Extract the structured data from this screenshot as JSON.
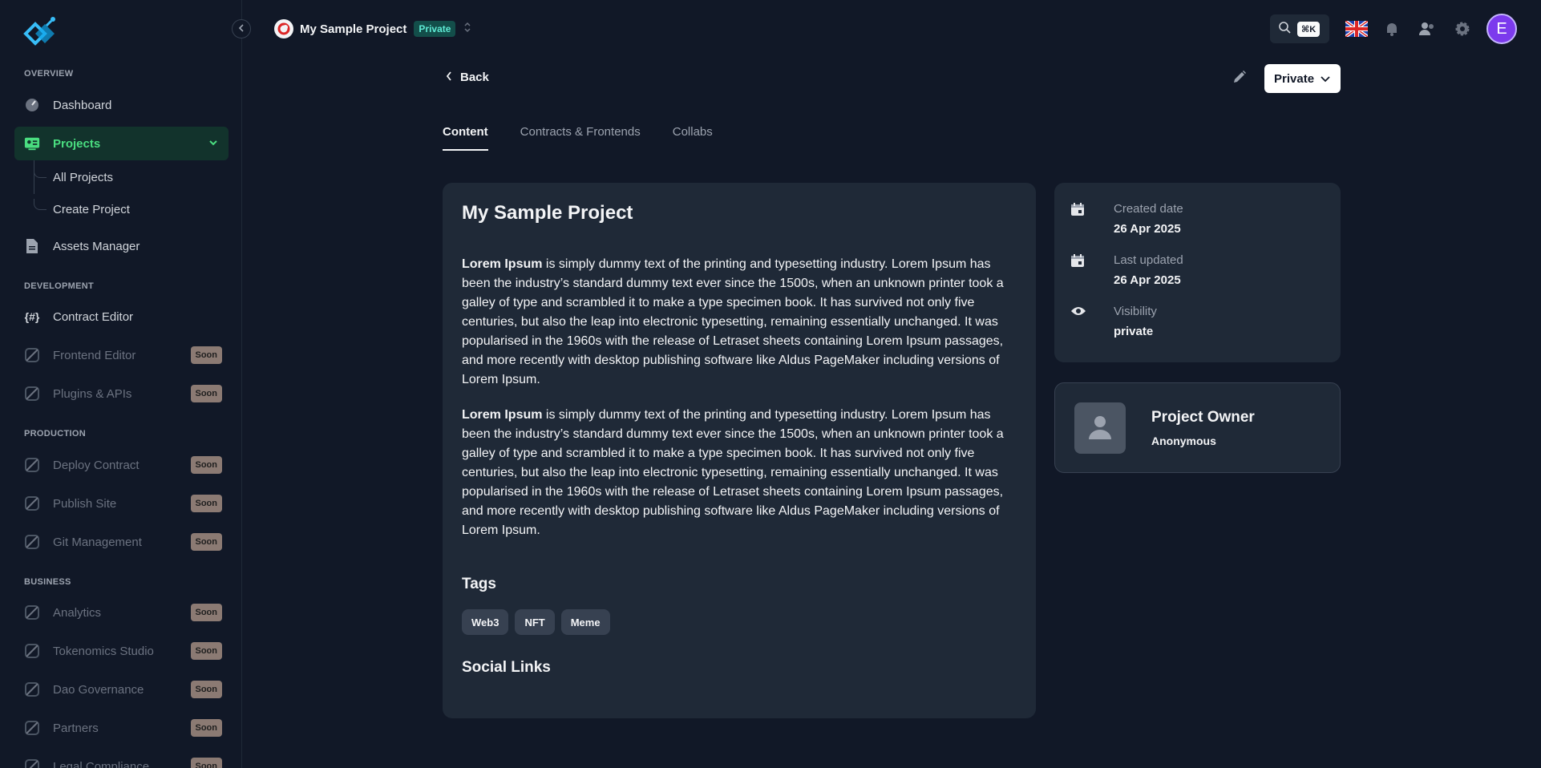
{
  "sidebar": {
    "sections": {
      "overview": "OVERVIEW",
      "development": "DEVELOPMENT",
      "production": "PRODUCTION",
      "business": "BUSINESS"
    },
    "items": {
      "dashboard": "Dashboard",
      "projects": "Projects",
      "all_projects": "All Projects",
      "create_project": "Create Project",
      "assets_manager": "Assets Manager",
      "contract_editor": "Contract Editor",
      "frontend_editor": "Frontend Editor",
      "plugins_apis": "Plugins & APIs",
      "deploy_contract": "Deploy Contract",
      "publish_site": "Publish Site",
      "git_management": "Git Management",
      "analytics": "Analytics",
      "tokenomics_studio": "Tokenomics Studio",
      "dao_governance": "Dao Governance",
      "partners": "Partners",
      "legal_compliance": "Legal Compliance"
    },
    "soon_label": "Soon"
  },
  "topbar": {
    "project_name": "My Sample Project",
    "project_badge": "Private",
    "search_shortcut": "⌘K",
    "user_initial": "E"
  },
  "main": {
    "back_label": "Back",
    "visibility_button": "Private",
    "tabs": [
      "Content",
      "Contracts & Frontends",
      "Collabs"
    ],
    "title": "My Sample Project",
    "paragraphs": [
      {
        "bold": "Lorem Ipsum",
        "text": " is simply dummy text of the printing and typesetting industry. Lorem Ipsum has been the industry’s standard dummy text ever since the 1500s, when an unknown printer took a galley of type and scrambled it to make a type specimen book. It has survived not only five centuries, but also the leap into electronic typesetting, remaining essentially unchanged. It was popularised in the 1960s with the release of Letraset sheets containing Lorem Ipsum passages, and more recently with desktop publishing software like Aldus PageMaker including versions of Lorem Ipsum."
      },
      {
        "bold": "Lorem Ipsum",
        "text": " is simply dummy text of the printing and typesetting industry. Lorem Ipsum has been the industry’s standard dummy text ever since the 1500s, when an unknown printer took a galley of type and scrambled it to make a type specimen book. It has survived not only five centuries, but also the leap into electronic typesetting, remaining essentially unchanged. It was popularised in the 1960s with the release of Letraset sheets containing Lorem Ipsum passages, and more recently with desktop publishing software like Aldus PageMaker including versions of Lorem Ipsum."
      }
    ],
    "tags_title": "Tags",
    "tags": [
      "Web3",
      "NFT",
      "Meme"
    ],
    "social_title": "Social Links"
  },
  "meta": {
    "created_label": "Created date",
    "created_value": "26 Apr 2025",
    "updated_label": "Last updated",
    "updated_value": "26 Apr 2025",
    "visibility_label": "Visibility",
    "visibility_value": "private"
  },
  "owner": {
    "title": "Project Owner",
    "name": "Anonymous"
  },
  "colors": {
    "background": "#111827",
    "card": "#1f2937",
    "accent_green": "#4ade80",
    "badge_teal": "#5eead4",
    "avatar_purple": "#7c3aed"
  }
}
